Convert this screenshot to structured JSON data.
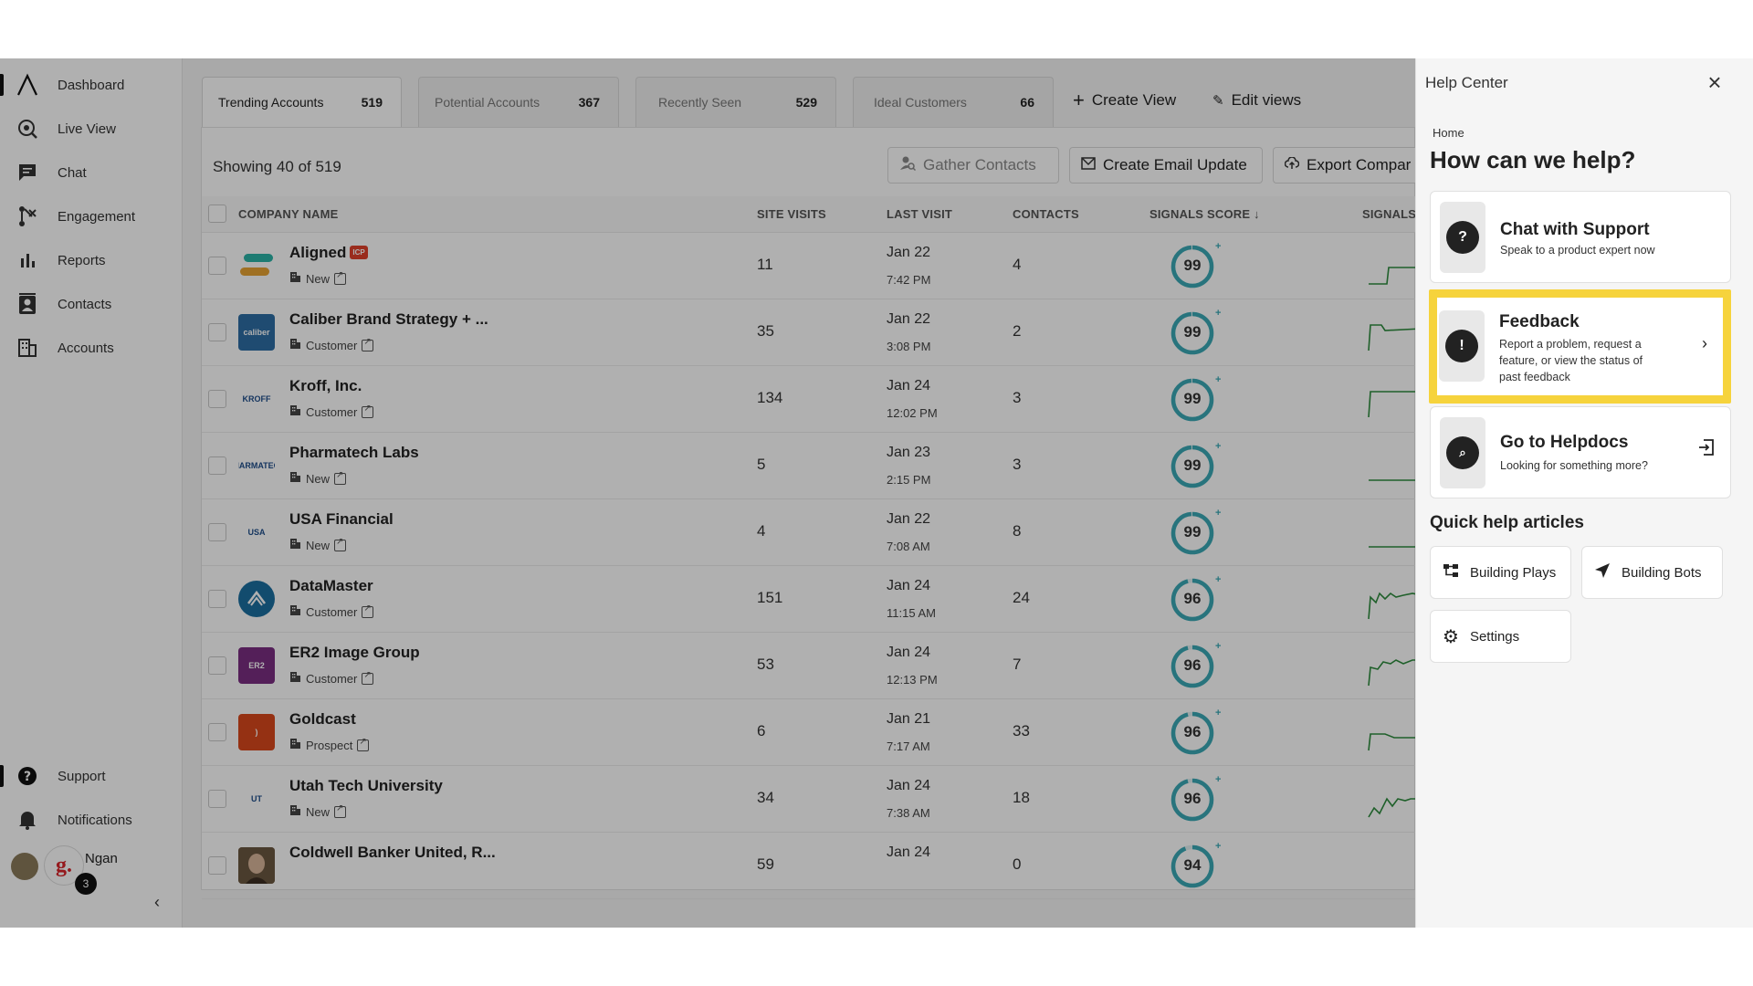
{
  "sidebar": {
    "items": [
      {
        "label": "Dashboard",
        "icon": "logo-icon"
      },
      {
        "label": "Live View",
        "icon": "live-view-icon"
      },
      {
        "label": "Chat",
        "icon": "chat-icon"
      },
      {
        "label": "Engagement",
        "icon": "engagement-icon"
      },
      {
        "label": "Reports",
        "icon": "bar-chart-icon"
      },
      {
        "label": "Contacts",
        "icon": "contacts-icon"
      },
      {
        "label": "Accounts",
        "icon": "building-icon"
      }
    ],
    "bottom": [
      {
        "label": "Support",
        "icon": "help-circle-icon"
      },
      {
        "label": "Notifications",
        "icon": "bell-icon"
      }
    ],
    "user_name": "Ngan",
    "user_initial": "g.",
    "badge": "3"
  },
  "tabs": [
    {
      "label": "Trending Accounts",
      "count": "519"
    },
    {
      "label": "Potential Accounts",
      "count": "367"
    },
    {
      "label": "Recently Seen",
      "count": "529"
    },
    {
      "label": "Ideal Customers",
      "count": "66"
    }
  ],
  "header_actions": {
    "create_view": "Create View",
    "edit_views": "Edit views"
  },
  "toolbar": {
    "showing": "Showing 40 of  519",
    "gather": "Gather Contacts",
    "email": "Create Email Update",
    "export": "Export Compar"
  },
  "table": {
    "columns": [
      "COMPANY NAME",
      "SITE VISITS",
      "LAST VISIT",
      "CONTACTS",
      "SIGNALS SCORE ↓",
      "SIGNALS"
    ],
    "rows": [
      {
        "name": "Aligned",
        "icp": "ICP",
        "type": "New",
        "visits": "11",
        "date": "Jan 22",
        "time": "7:42 PM",
        "contacts": "4",
        "score": "99",
        "score_pct": 0.99
      },
      {
        "name": "Caliber Brand Strategy + ...",
        "type": "Customer",
        "visits": "35",
        "date": "Jan 22",
        "time": "3:08 PM",
        "contacts": "2",
        "score": "99",
        "score_pct": 0.99
      },
      {
        "name": "Kroff, Inc.",
        "type": "Customer",
        "visits": "134",
        "date": "Jan 24",
        "time": "12:02 PM",
        "contacts": "3",
        "score": "99",
        "score_pct": 0.99
      },
      {
        "name": "Pharmatech Labs",
        "type": "New",
        "visits": "5",
        "date": "Jan 23",
        "time": "2:15 PM",
        "contacts": "3",
        "score": "99",
        "score_pct": 0.99
      },
      {
        "name": "USA Financial",
        "type": "New",
        "visits": "4",
        "date": "Jan 22",
        "time": "7:08 AM",
        "contacts": "8",
        "score": "99",
        "score_pct": 0.99
      },
      {
        "name": "DataMaster",
        "type": "Customer",
        "visits": "151",
        "date": "Jan 24",
        "time": "11:15 AM",
        "contacts": "24",
        "score": "96",
        "score_pct": 0.96
      },
      {
        "name": "ER2 Image Group",
        "type": "Customer",
        "visits": "53",
        "date": "Jan 24",
        "time": "12:13 PM",
        "contacts": "7",
        "score": "96",
        "score_pct": 0.96
      },
      {
        "name": "Goldcast",
        "type": "Prospect",
        "visits": "6",
        "date": "Jan 21",
        "time": "7:17 AM",
        "contacts": "33",
        "score": "96",
        "score_pct": 0.96
      },
      {
        "name": "Utah Tech University",
        "type": "New",
        "visits": "34",
        "date": "Jan 24",
        "time": "7:38 AM",
        "contacts": "18",
        "score": "96",
        "score_pct": 0.96
      },
      {
        "name": "Coldwell Banker United, R...",
        "type": "",
        "visits": "59",
        "date": "Jan 24",
        "time": "",
        "contacts": "0",
        "score": "94",
        "score_pct": 0.94
      }
    ],
    "logos": [
      {
        "text": "",
        "bg": "#ffffff"
      },
      {
        "text": "caliber",
        "bg": "#2e6da4"
      },
      {
        "text": "KROFF",
        "bg": "#ffffff"
      },
      {
        "text": "PHARMATECH",
        "bg": "#ffffff"
      },
      {
        "text": "USA",
        "bg": "#ffffff"
      },
      {
        "text": "",
        "bg": "#1b6fa0"
      },
      {
        "text": "ER2",
        "bg": "#7a2d82"
      },
      {
        "text": ")",
        "bg": "#d8481c"
      },
      {
        "text": "UT",
        "bg": "#ffffff"
      },
      {
        "text": "",
        "bg": "#7a5b3e"
      }
    ]
  },
  "help": {
    "title": "Help Center",
    "breadcrumb": "Home",
    "heading": "How can we help?",
    "cards": [
      {
        "title": "Chat with Support",
        "desc": "Speak to a product expert now",
        "icon": "question-bubble-icon"
      },
      {
        "title": "Feedback",
        "desc": "Report a problem, request a feature, or view the status of past feedback",
        "icon": "feedback-bubble-icon"
      },
      {
        "title": "Go to Helpdocs",
        "desc": "Looking for something more?",
        "icon": "doc-search-icon"
      }
    ],
    "quick_title": "Quick help articles",
    "quick": [
      {
        "label": "Building Plays",
        "icon": "flow-icon"
      },
      {
        "label": "Building Bots",
        "icon": "send-icon"
      },
      {
        "label": "Settings",
        "icon": "gear-icon"
      }
    ]
  },
  "colors": {
    "score_ring": "#3aa9b5",
    "spark": "#2e8b3e",
    "highlight": "#f6d33c",
    "overlay": "rgba(0,0,0,0.31)"
  }
}
